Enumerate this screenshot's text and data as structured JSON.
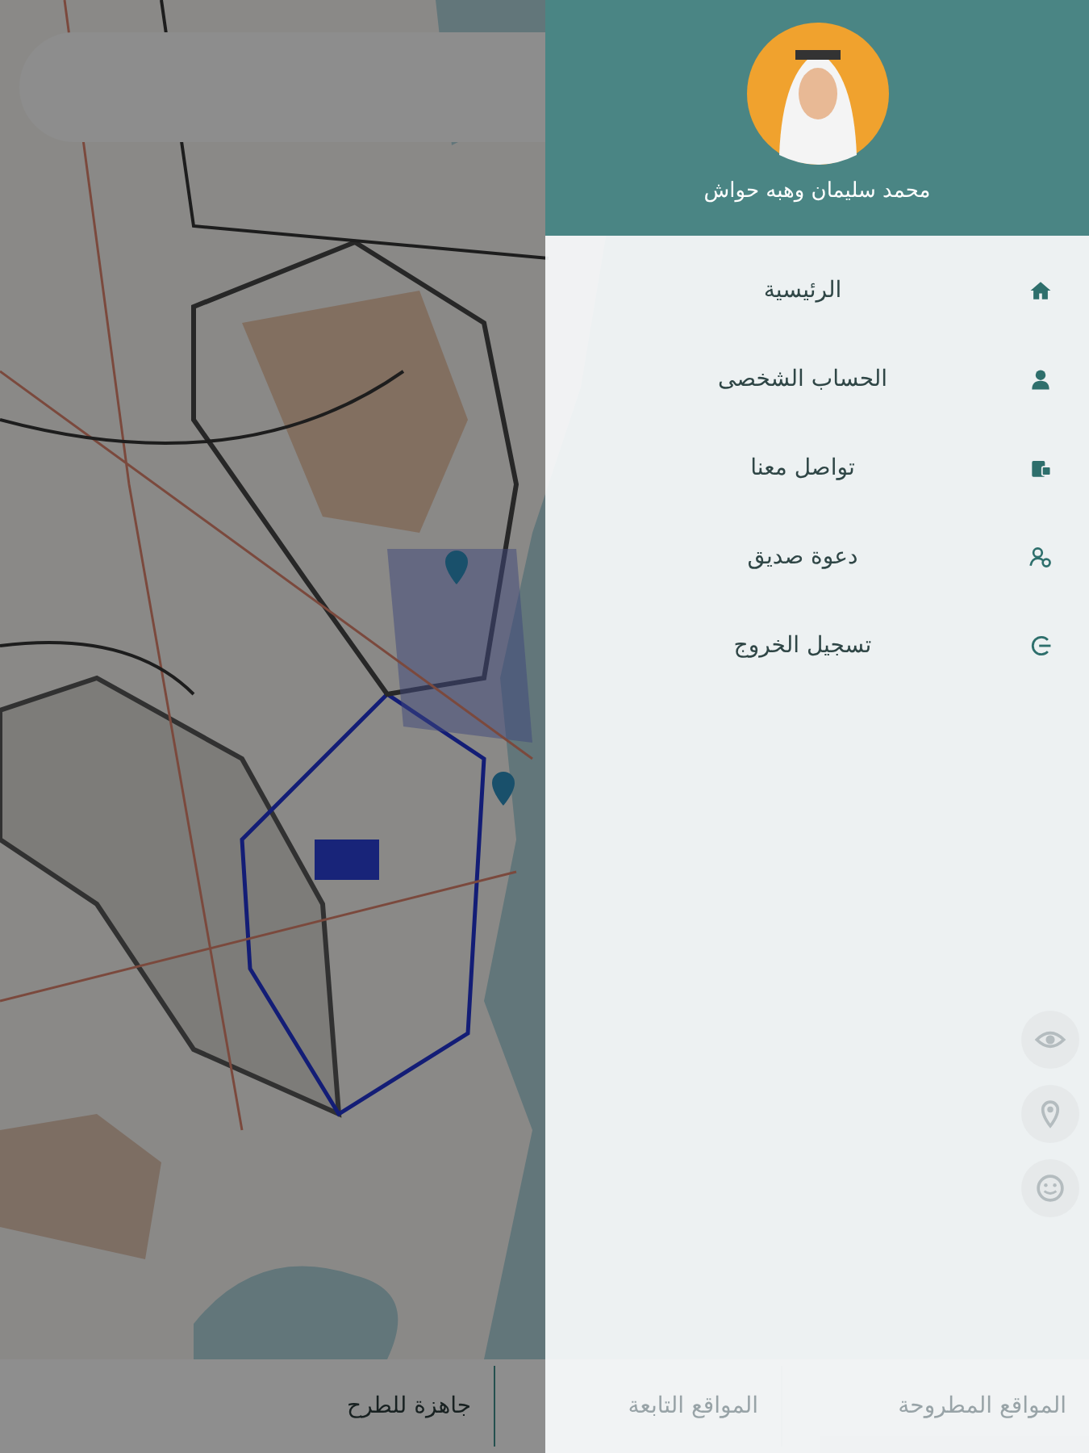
{
  "map_buttons": [
    {
      "kind": "eye"
    },
    {
      "kind": "pin"
    },
    {
      "kind": "face"
    }
  ],
  "bottom_tabs": [
    {
      "label": "المواقع المطروحة"
    },
    {
      "label": "المواقع التابعة"
    },
    {
      "label": "جاهزة للطرح"
    }
  ],
  "drawer": {
    "user_name": "محمد سليمان وهبه حواش",
    "items": [
      {
        "kind": "home",
        "label": "الرئيسية"
      },
      {
        "kind": "person",
        "label": "الحساب الشخصى"
      },
      {
        "kind": "contact",
        "label": "تواصل معنا"
      },
      {
        "kind": "invite",
        "label": "دعوة صديق"
      },
      {
        "kind": "logout",
        "label": "تسجيل الخروج"
      }
    ]
  }
}
